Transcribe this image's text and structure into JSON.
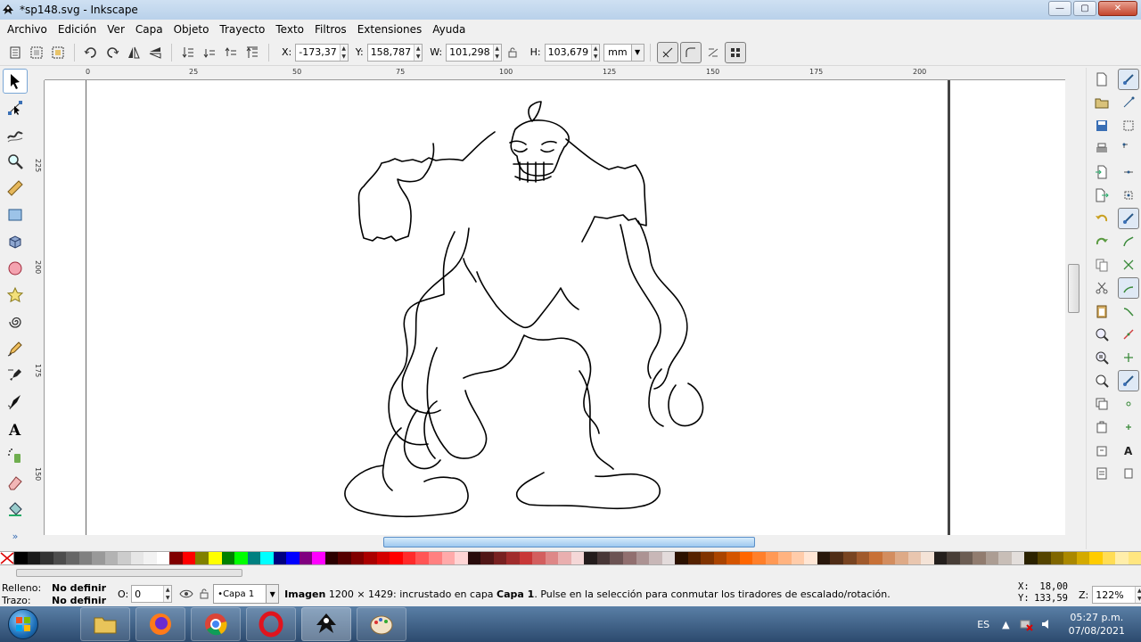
{
  "window": {
    "title": "*sp148.svg - Inkscape",
    "minimize": "—",
    "maximize": "▢",
    "close": "✕"
  },
  "menu": [
    "Archivo",
    "Edición",
    "Ver",
    "Capa",
    "Objeto",
    "Trayecto",
    "Texto",
    "Filtros",
    "Extensiones",
    "Ayuda"
  ],
  "toolcontrols": {
    "x_label": "X:",
    "x_value": "-173,37",
    "y_label": "Y:",
    "y_value": "158,787",
    "w_label": "W:",
    "w_value": "101,298",
    "h_label": "H:",
    "h_value": "103,679",
    "unit": "mm"
  },
  "ruler": {
    "h_ticks": [
      "0",
      "25",
      "50",
      "75",
      "100",
      "125",
      "150",
      "175",
      "200"
    ],
    "v_ticks": [
      "225",
      "200",
      "175",
      "150"
    ]
  },
  "palette": {
    "colors": [
      "#000000",
      "#1a1a1a",
      "#333333",
      "#4d4d4d",
      "#666666",
      "#808080",
      "#999999",
      "#b3b3b3",
      "#cccccc",
      "#e6e6e6",
      "#f2f2f2",
      "#ffffff",
      "#800000",
      "#ff0000",
      "#808000",
      "#ffff00",
      "#008000",
      "#00ff00",
      "#008080",
      "#00ffff",
      "#000080",
      "#0000ff",
      "#800080",
      "#ff00ff",
      "#2b0000",
      "#550000",
      "#800000",
      "#aa0000",
      "#d40000",
      "#ff0000",
      "#ff2a2a",
      "#ff5555",
      "#ff8080",
      "#ffaaaa",
      "#ffd5d5",
      "#280b0b",
      "#501616",
      "#782121",
      "#a02c2c",
      "#c83737",
      "#d35f5f",
      "#de8787",
      "#e9afaf",
      "#f4d7d7",
      "#241c1c",
      "#483737",
      "#6c5353",
      "#916f6f",
      "#ac9393",
      "#c8b7b7",
      "#e3dbdb",
      "#2b1100",
      "#552200",
      "#803300",
      "#aa4400",
      "#d45500",
      "#ff6600",
      "#ff7f2a",
      "#ff9955",
      "#ffb380",
      "#ffccaa",
      "#ffe6d5",
      "#28170b",
      "#502d16",
      "#784421",
      "#a05a2c",
      "#c87137",
      "#d38d5f",
      "#deaa87",
      "#e9c6af",
      "#f4e3d7",
      "#241f1c",
      "#483e37",
      "#6c5d53",
      "#917c6f",
      "#ac9d93",
      "#c8beb7",
      "#e3dedb",
      "#2b2200",
      "#554400",
      "#806600",
      "#aa8800",
      "#d4aa00",
      "#ffcc00",
      "#ffdd55",
      "#ffeeaa",
      "#ffe680"
    ]
  },
  "status": {
    "fill_label": "Relleno:",
    "fill_value": "No definir",
    "stroke_label": "Trazo:",
    "stroke_value": "No definir",
    "opacity_label": "O:",
    "opacity_value": "0",
    "layer": "•Capa 1",
    "message_bold": "Imagen",
    "message_mid": " 1200 × 1429: incrustado en capa ",
    "message_layer": "Capa 1",
    "message_end": ". Pulse en la selección para conmutar los tiradores de escalado/rotación.",
    "x_label": "X:",
    "x_value": "18,00",
    "y_label": "Y:",
    "y_value": "133,59",
    "zoom_label": "Z:",
    "zoom_value": "122%"
  },
  "taskbar": {
    "language": "ES",
    "time": "05:27 p.m.",
    "date": "07/08/2021"
  }
}
